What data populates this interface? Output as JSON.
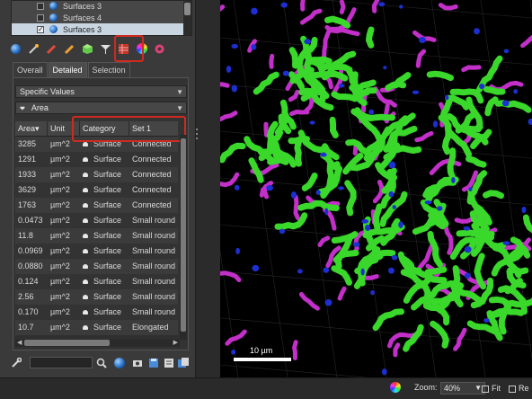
{
  "tree": {
    "items": [
      {
        "label": "Surfaces 3",
        "checked": false,
        "selected": false
      },
      {
        "label": "Surfaces 4",
        "checked": false,
        "selected": false
      },
      {
        "label": "Surfaces 3",
        "checked": true,
        "selected": true
      }
    ]
  },
  "toolbar": {
    "icons": [
      "properties-sphere-icon",
      "wand-icon",
      "pencil-red-icon",
      "pencil-orange-icon",
      "cube-icon",
      "filter-icon",
      "statistics-icon",
      "color-wheel-icon",
      "gear-icon"
    ]
  },
  "tabs": [
    {
      "label": "Overall",
      "active": false
    },
    {
      "label": "Detailed",
      "active": true
    },
    {
      "label": "Selection",
      "active": false
    }
  ],
  "selects": {
    "mode": "Specific Values",
    "stat": "Area",
    "stat_icon": "❤"
  },
  "table": {
    "headers": [
      "Area",
      "Unit",
      "Category",
      "Set 1"
    ],
    "sort_indicator": "▾",
    "rows": [
      [
        "3285",
        "µm^2",
        "Surface",
        "Connected"
      ],
      [
        "1291",
        "µm^2",
        "Surface",
        "Connected"
      ],
      [
        "1933",
        "µm^2",
        "Surface",
        "Connected"
      ],
      [
        "3629",
        "µm^2",
        "Surface",
        "Connected"
      ],
      [
        "1763",
        "µm^2",
        "Surface",
        "Connected"
      ],
      [
        "0.0473",
        "µm^2",
        "Surface",
        "Small round"
      ],
      [
        "11.8",
        "µm^2",
        "Surface",
        "Small round"
      ],
      [
        "0.0969",
        "µm^2",
        "Surface",
        "Small round"
      ],
      [
        "0.0880",
        "µm^2",
        "Surface",
        "Small round"
      ],
      [
        "0.124",
        "µm^2",
        "Surface",
        "Small round"
      ],
      [
        "2.56",
        "µm^2",
        "Surface",
        "Small round"
      ],
      [
        "0.170",
        "µm^2",
        "Surface",
        "Small round"
      ],
      [
        "10.7",
        "µm^2",
        "Surface",
        "Elongated"
      ]
    ]
  },
  "filter": {
    "value": ""
  },
  "viewer": {
    "scale_label": "10 µm"
  },
  "status": {
    "zoom_label": "Zoom:",
    "zoom_value": "40%",
    "fit_label": "Fit",
    "re_label": "Re"
  },
  "colors": {
    "highlight": "#d02a20",
    "green_surface": "#39d82a",
    "magenta_surface": "#c22fc9",
    "blue_spot": "#1d2fd0"
  }
}
